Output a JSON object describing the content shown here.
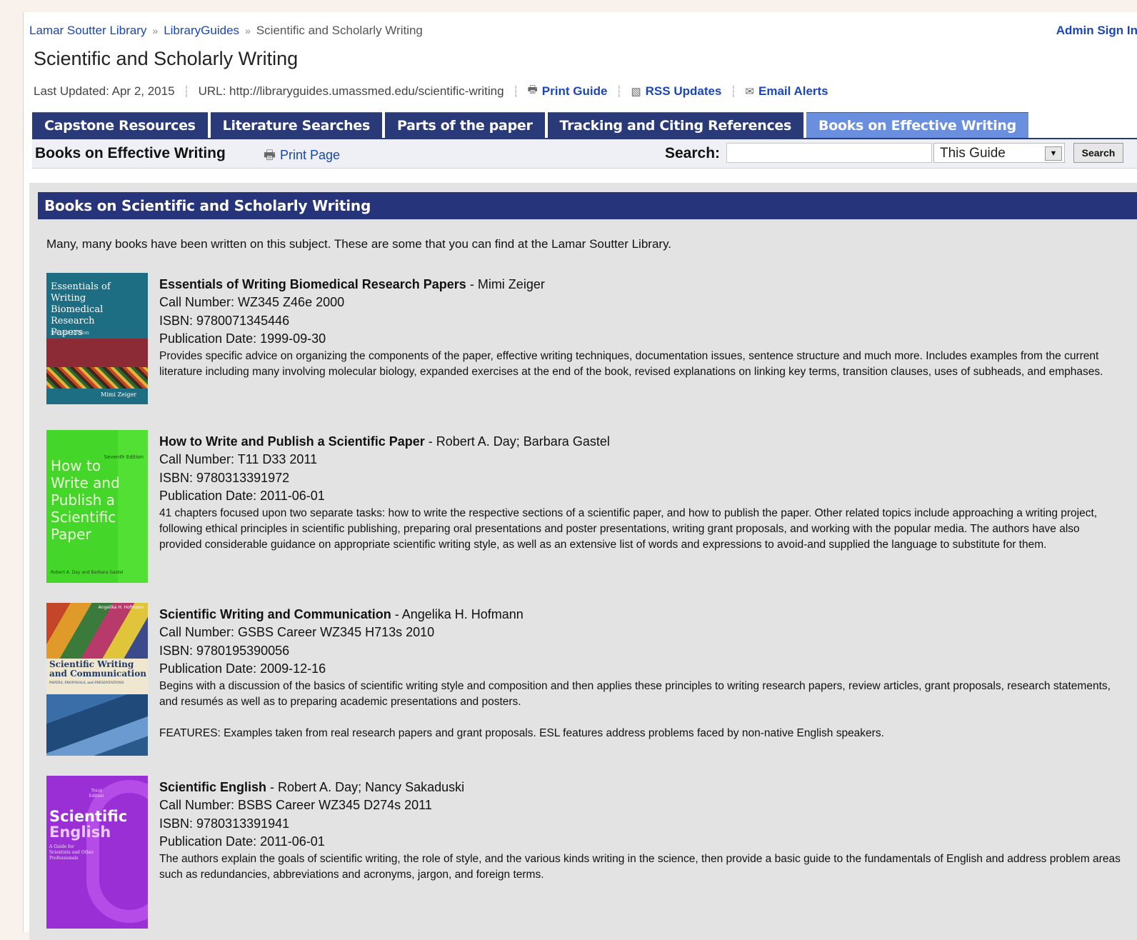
{
  "breadcrumb": {
    "items": [
      "Lamar Soutter Library",
      "LibraryGuides",
      "Scientific and Scholarly Writing"
    ],
    "separator": "»"
  },
  "admin_link": "Admin Sign In",
  "guide_title": "Scientific and Scholarly Writing",
  "meta": {
    "last_updated": "Last Updated: Apr 2, 2015",
    "url": "URL: http://libraryguides.umassmed.edu/scientific-writing",
    "print_guide": "Print Guide",
    "rss_updates": "RSS Updates",
    "email_alerts": "Email Alerts"
  },
  "tabs": [
    {
      "label": "Capstone Resources",
      "active": false
    },
    {
      "label": "Literature Searches",
      "active": false
    },
    {
      "label": "Parts of the paper",
      "active": false
    },
    {
      "label": "Tracking and Citing References",
      "active": false
    },
    {
      "label": "Books on Effective Writing",
      "active": true
    }
  ],
  "page_bar": {
    "title": "Books on Effective Writing",
    "print_page": "Print Page",
    "search_label": "Search:",
    "search_value": "",
    "scope_selected": "This Guide",
    "search_button": "Search"
  },
  "box": {
    "header": "Books on Scientific and Scholarly Writing",
    "intro": "Many, many books have been written on this subject. These are some that you can find at the Lamar Soutter Library."
  },
  "books": [
    {
      "title": "Essentials of Writing Biomedical Research Papers",
      "author": " - Mimi Zeiger",
      "call_number": "Call Number: WZ345 Z46e 2000",
      "isbn": "ISBN: 9780071345446",
      "pub_date": "Publication Date: 1999-09-30",
      "description": [
        "Provides specific advice on organizing the components of the paper, effective writing techniques, documentation issues, sentence structure and much more. Includes examples from the current literature including many involving molecular biology, expanded exercises at the end of the book, revised explanations on linking key terms, transition clauses, uses of subheads, and emphases."
      ],
      "cover_lines": [
        "Essentials of Writing",
        "Biomedical",
        "Research",
        "Papers"
      ],
      "cover_edition": "Second Edition",
      "cover_author": "Mimi Zeiger",
      "cover_color": "#1f6a7e"
    },
    {
      "title": "How to Write and Publish a Scientific Paper",
      "author": " - Robert A. Day; Barbara Gastel",
      "call_number": "Call Number: T11 D33 2011",
      "isbn": "ISBN: 9780313391972",
      "pub_date": "Publication Date: 2011-06-01",
      "description": [
        "41 chapters focused upon two separate tasks: how to write the respective sections of a scientific paper, and how to publish the paper. Other related topics include approaching a writing project, following ethical principles in scientific publishing, preparing oral presentations and poster presentations, writing grant proposals, and working with the popular media. The authors have also provided considerable guidance on appropriate scientific writing style, as well as an extensive list of words and expressions to avoid-and supplied the language to substitute for them."
      ],
      "cover_lines": [
        "How to",
        "Write and",
        "Publish a",
        "Scientific",
        "Paper"
      ],
      "cover_edition": "Seventh Edition",
      "cover_author": "Robert A. Day and Barbara Gastel",
      "cover_color": "#45d62a"
    },
    {
      "title": "Scientific Writing and Communication",
      "author": " - Angelika H. Hofmann",
      "call_number": "Call Number: GSBS Career WZ345 H713s 2010",
      "isbn": "ISBN: 9780195390056",
      "pub_date": "Publication Date: 2009-12-16",
      "description": [
        "Begins with a discussion of the basics of scientific writing style and composition and then applies these principles to writing research papers, review articles, grant proposals, research statements, and resumés as well as to preparing academic presentations and posters.",
        "FEATURES: Examples taken from real research papers and grant proposals. ESL features address problems faced by non-native English speakers."
      ],
      "cover_lines": [
        "Scientific Writing",
        "and Communication"
      ],
      "cover_sub": "PAPERS, PROPOSALS, and PRESENTATIONS",
      "cover_author": "Angelika H. Hofmann",
      "cover_color": "#2a5a8c"
    },
    {
      "title": "Scientific English",
      "author": " - Robert A. Day; Nancy Sakaduski",
      "call_number": "Call Number: BSBS Career WZ345 D274s 2011",
      "isbn": "ISBN: 9780313391941",
      "pub_date": "Publication Date: 2011-06-01",
      "description": [
        "The authors explain the goals of scientific writing, the role of style, and the various kinds writing in the science, then provide a basic guide to the fundamentals of English and address problem areas such as redundancies, abbreviations and acronyms, jargon, and foreign terms."
      ],
      "cover_lines": [
        "Scientific",
        "English"
      ],
      "cover_edition": "Third Edition",
      "cover_sub": "A Guide for Scientists and Other Professionals",
      "cover_color": "#9a2fd6"
    }
  ]
}
